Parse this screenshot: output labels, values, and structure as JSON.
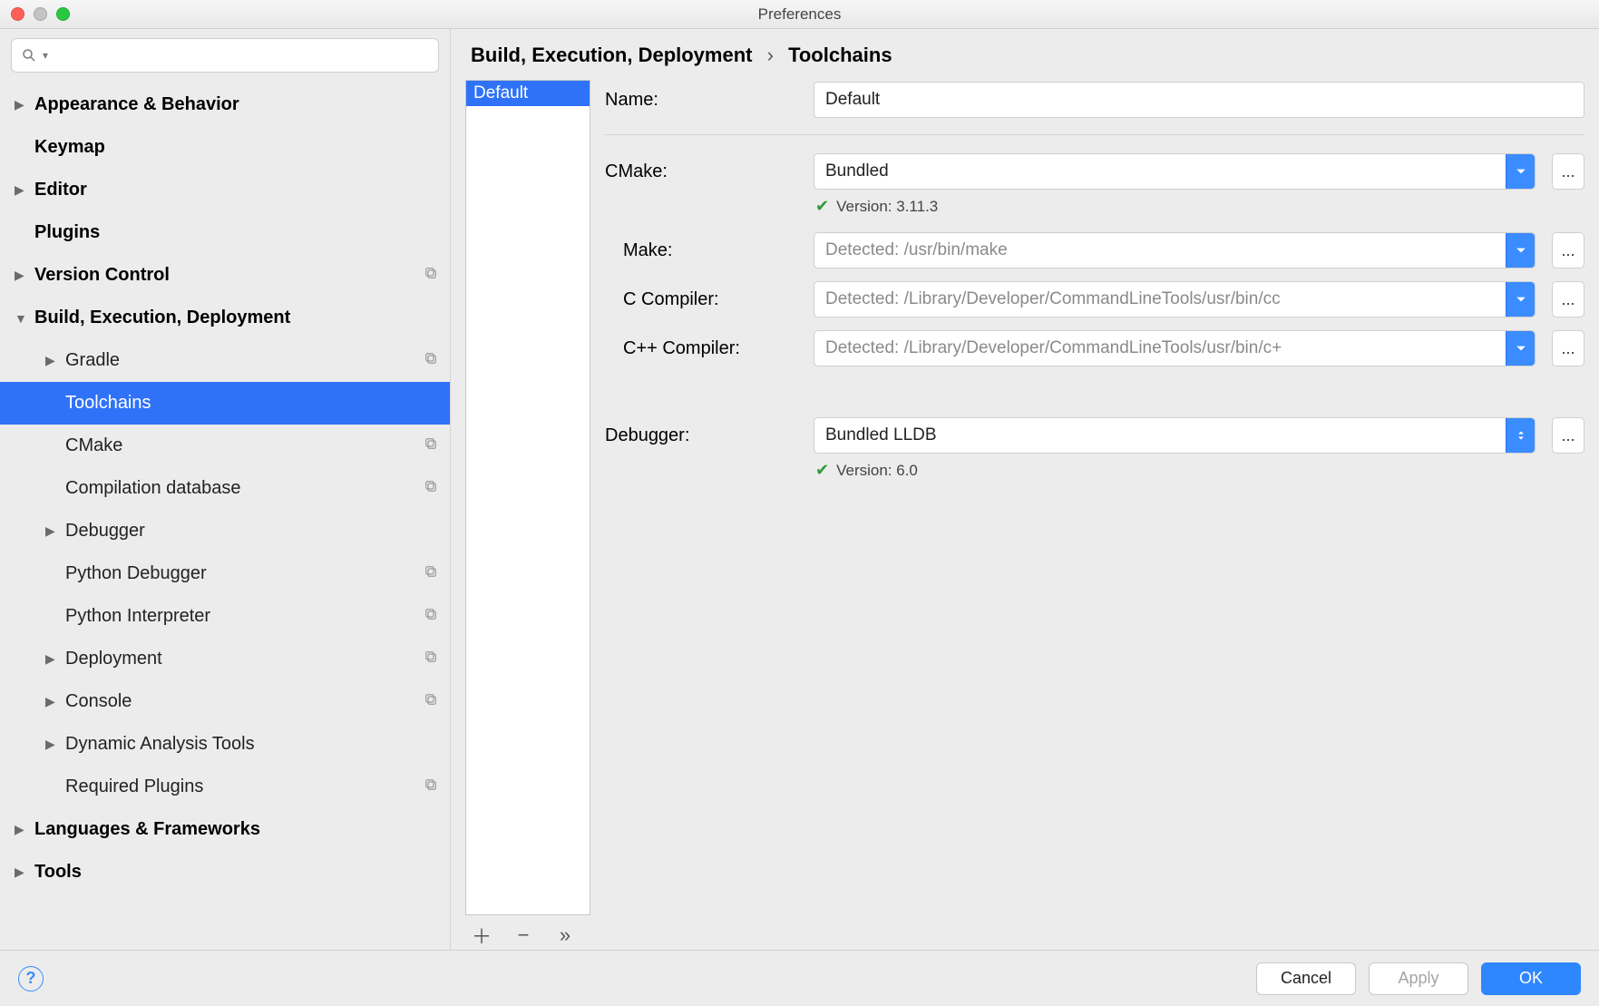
{
  "window": {
    "title": "Preferences"
  },
  "sidebar": {
    "search_placeholder": "",
    "items": [
      {
        "label": "Appearance & Behavior",
        "bold": true,
        "expand": "closed"
      },
      {
        "label": "Keymap",
        "bold": true,
        "expand": "none"
      },
      {
        "label": "Editor",
        "bold": true,
        "expand": "closed"
      },
      {
        "label": "Plugins",
        "bold": true,
        "expand": "none"
      },
      {
        "label": "Version Control",
        "bold": true,
        "expand": "closed",
        "copy": true
      },
      {
        "label": "Build, Execution, Deployment",
        "bold": true,
        "expand": "open"
      },
      {
        "label": "Gradle",
        "indent": 1,
        "expand": "closed",
        "copy": true
      },
      {
        "label": "Toolchains",
        "indent": 1,
        "expand": "none",
        "selected": true
      },
      {
        "label": "CMake",
        "indent": 1,
        "expand": "none",
        "copy": true
      },
      {
        "label": "Compilation database",
        "indent": 1,
        "expand": "none",
        "copy": true
      },
      {
        "label": "Debugger",
        "indent": 1,
        "expand": "closed"
      },
      {
        "label": "Python Debugger",
        "indent": 1,
        "expand": "none",
        "copy": true
      },
      {
        "label": "Python Interpreter",
        "indent": 1,
        "expand": "none",
        "copy": true
      },
      {
        "label": "Deployment",
        "indent": 1,
        "expand": "closed",
        "copy": true
      },
      {
        "label": "Console",
        "indent": 1,
        "expand": "closed",
        "copy": true
      },
      {
        "label": "Dynamic Analysis Tools",
        "indent": 1,
        "expand": "closed"
      },
      {
        "label": "Required Plugins",
        "indent": 1,
        "expand": "none",
        "copy": true
      },
      {
        "label": "Languages & Frameworks",
        "bold": true,
        "expand": "closed"
      },
      {
        "label": "Tools",
        "bold": true,
        "expand": "closed"
      }
    ]
  },
  "breadcrumb": {
    "root": "Build, Execution, Deployment",
    "leaf": "Toolchains"
  },
  "list": {
    "selected": "Default"
  },
  "form": {
    "name_label": "Name:",
    "name_value": "Default",
    "cmake_label": "CMake:",
    "cmake_value": "Bundled",
    "cmake_status": "Version: 3.11.3",
    "make_label": "Make:",
    "make_placeholder": "Detected: /usr/bin/make",
    "cc_label": "C Compiler:",
    "cc_placeholder": "Detected: /Library/Developer/CommandLineTools/usr/bin/cc",
    "cxx_label": "C++ Compiler:",
    "cxx_placeholder": "Detected: /Library/Developer/CommandLineTools/usr/bin/c+",
    "debugger_label": "Debugger:",
    "debugger_value": "Bundled LLDB",
    "debugger_status": "Version: 6.0"
  },
  "footer": {
    "cancel": "Cancel",
    "apply": "Apply",
    "ok": "OK"
  },
  "glyph": {
    "dots": "..."
  }
}
